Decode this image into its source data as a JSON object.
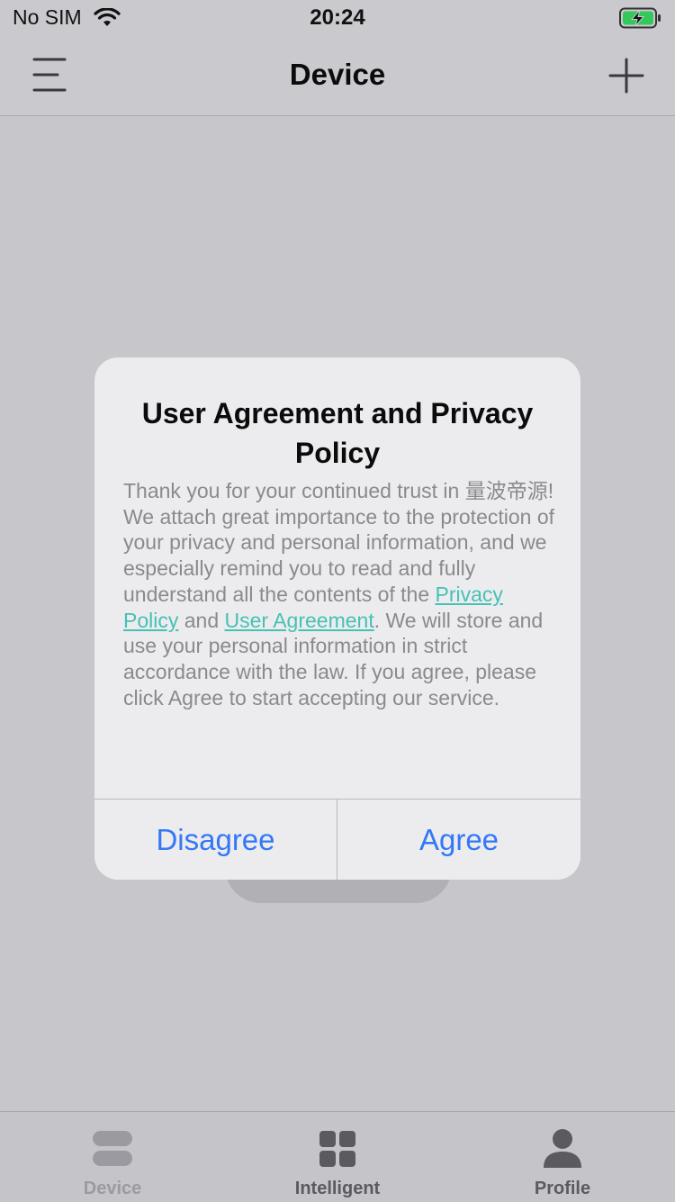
{
  "status_bar": {
    "carrier": "No SIM",
    "time": "20:24",
    "wifi_icon": "wifi-icon",
    "battery_icon": "battery-charging-icon",
    "battery_color": "#34c759"
  },
  "nav": {
    "title": "Device",
    "menu_icon": "menu-icon",
    "add_icon": "plus-icon"
  },
  "dialog": {
    "title": "User Agreement and Privacy Policy",
    "body_intro": "Thank you for your continued trust in 量波帝源!",
    "body_before_links": "We attach great importance to the protection of your privacy and personal information, and we especially remind you to read and fully understand all the contents of the ",
    "privacy_link": "Privacy Policy",
    "and_text": " and ",
    "user_link": "User Agreement",
    "body_after_links": ". We will store and use your personal information in strict accordance with the law. If you agree, please click Agree to start accepting our service.",
    "disagree_label": "Disagree",
    "agree_label": "Agree",
    "link_color": "#46c1b6",
    "button_color": "#3478f6"
  },
  "tabs": [
    {
      "label": "Device",
      "icon": "device-icon"
    },
    {
      "label": "Intelligent",
      "icon": "grid-icon"
    },
    {
      "label": "Profile",
      "icon": "profile-icon"
    }
  ]
}
